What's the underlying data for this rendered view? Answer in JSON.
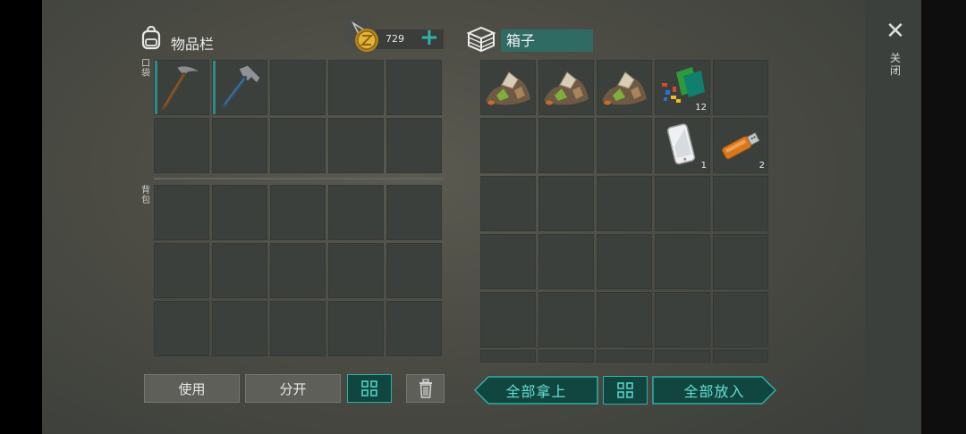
{
  "inventory": {
    "title": "物品栏",
    "currency_value": "729",
    "add_symbol": "+",
    "pocket_label": "口袋",
    "backpack_label": "背包",
    "pocket_items": [
      "pickaxe-icon",
      "hammer-icon",
      "",
      "",
      "",
      "",
      "",
      "",
      "",
      ""
    ],
    "backpack_slot_count": 15
  },
  "container": {
    "title": "箱子",
    "items": [
      {
        "icon": "ore-pile-icon",
        "count": ""
      },
      {
        "icon": "ore-pile-icon",
        "count": ""
      },
      {
        "icon": "ore-pile-icon",
        "count": ""
      },
      {
        "icon": "colored-parts-icon",
        "count": "12"
      },
      {
        "icon": "",
        "count": ""
      },
      {
        "icon": "",
        "count": ""
      },
      {
        "icon": "",
        "count": ""
      },
      {
        "icon": "",
        "count": ""
      },
      {
        "icon": "smartphone-icon",
        "count": "1"
      },
      {
        "icon": "usb-drive-icon",
        "count": "2"
      }
    ],
    "empty_slot_count": 15
  },
  "actions": {
    "use_label": "使用",
    "split_label": "分开",
    "take_all_label": "全部拿上",
    "put_all_label": "全部放入"
  },
  "close": {
    "symbol": "✕",
    "label": "关闭"
  },
  "colors": {
    "accent_teal": "#2fb1a6",
    "slot_bg": "#3b403d",
    "title_box_bg": "#2f6a63"
  }
}
